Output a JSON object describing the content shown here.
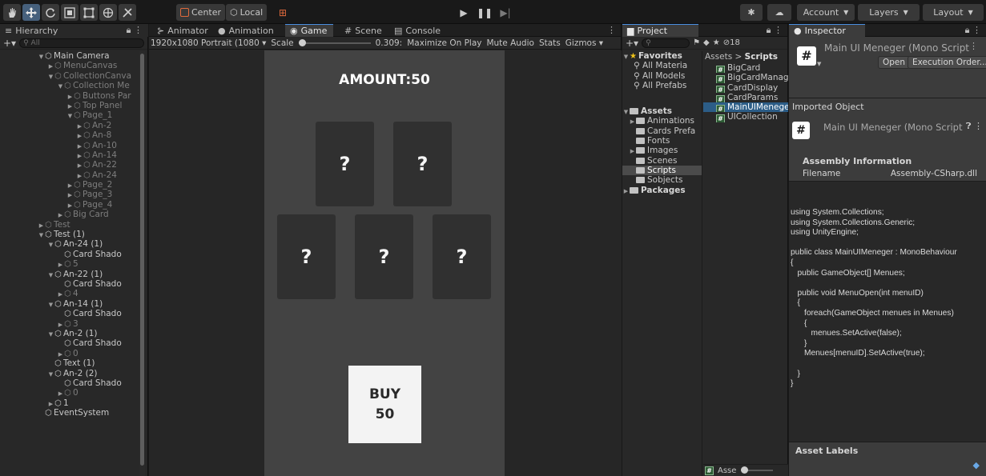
{
  "toolbar": {
    "pivot_label": "Center",
    "space_label": "Local",
    "account_label": "Account",
    "layers_label": "Layers",
    "layout_label": "Layout"
  },
  "hierarchy": {
    "tab_label": "Hierarchy",
    "search_placeholder": "All",
    "rows": [
      {
        "label": "Main Camera",
        "arrow": "▼",
        "depth": 1,
        "dim": false
      },
      {
        "label": "MenuCanvas",
        "arrow": "▶",
        "depth": 2,
        "dim": true
      },
      {
        "label": "CollectionCanva",
        "arrow": "▼",
        "depth": 2,
        "dim": true
      },
      {
        "label": "Collection Me",
        "arrow": "▼",
        "depth": 3,
        "dim": true
      },
      {
        "label": "Buttons Par",
        "arrow": "▶",
        "depth": 4,
        "dim": true
      },
      {
        "label": "Top Panel",
        "arrow": "▶",
        "depth": 4,
        "dim": true
      },
      {
        "label": "Page_1",
        "arrow": "▼",
        "depth": 4,
        "dim": true
      },
      {
        "label": "An-2",
        "arrow": "▶",
        "depth": 5,
        "dim": true
      },
      {
        "label": "An-8",
        "arrow": "▶",
        "depth": 5,
        "dim": true
      },
      {
        "label": "An-10",
        "arrow": "▶",
        "depth": 5,
        "dim": true
      },
      {
        "label": "An-14",
        "arrow": "▶",
        "depth": 5,
        "dim": true
      },
      {
        "label": "An-22",
        "arrow": "▶",
        "depth": 5,
        "dim": true
      },
      {
        "label": "An-24",
        "arrow": "▶",
        "depth": 5,
        "dim": true
      },
      {
        "label": "Page_2",
        "arrow": "▶",
        "depth": 4,
        "dim": true
      },
      {
        "label": "Page_3",
        "arrow": "▶",
        "depth": 4,
        "dim": true
      },
      {
        "label": "Page_4",
        "arrow": "▶",
        "depth": 4,
        "dim": true
      },
      {
        "label": "Big Card",
        "arrow": "▶",
        "depth": 3,
        "dim": true
      },
      {
        "label": "Test",
        "arrow": "▶",
        "depth": 1,
        "dim": true
      },
      {
        "label": "Test (1)",
        "arrow": "▼",
        "depth": 1,
        "dim": false
      },
      {
        "label": "An-24 (1)",
        "arrow": "▼",
        "depth": 2,
        "dim": false
      },
      {
        "label": "Card Shado",
        "arrow": "",
        "depth": 3,
        "dim": false
      },
      {
        "label": "5",
        "arrow": "▶",
        "depth": 3,
        "dim": true
      },
      {
        "label": "An-22 (1)",
        "arrow": "▼",
        "depth": 2,
        "dim": false
      },
      {
        "label": "Card Shado",
        "arrow": "",
        "depth": 3,
        "dim": false
      },
      {
        "label": "4",
        "arrow": "▶",
        "depth": 3,
        "dim": true
      },
      {
        "label": "An-14 (1)",
        "arrow": "▼",
        "depth": 2,
        "dim": false
      },
      {
        "label": "Card Shado",
        "arrow": "",
        "depth": 3,
        "dim": false
      },
      {
        "label": "3",
        "arrow": "▶",
        "depth": 3,
        "dim": true
      },
      {
        "label": "An-2 (1)",
        "arrow": "▼",
        "depth": 2,
        "dim": false
      },
      {
        "label": "Card Shado",
        "arrow": "",
        "depth": 3,
        "dim": false
      },
      {
        "label": "0",
        "arrow": "▶",
        "depth": 3,
        "dim": true
      },
      {
        "label": "Text (1)",
        "arrow": "",
        "depth": 2,
        "dim": false
      },
      {
        "label": "An-2 (2)",
        "arrow": "▼",
        "depth": 2,
        "dim": false
      },
      {
        "label": "Card Shado",
        "arrow": "",
        "depth": 3,
        "dim": false
      },
      {
        "label": "0",
        "arrow": "▶",
        "depth": 3,
        "dim": true
      },
      {
        "label": "1",
        "arrow": "▶",
        "depth": 2,
        "dim": false
      },
      {
        "label": "EventSystem",
        "arrow": "",
        "depth": 1,
        "dim": false
      }
    ]
  },
  "game": {
    "tabs": [
      {
        "label": "Animator",
        "icon": "⊱"
      },
      {
        "label": "Animation",
        "icon": "●"
      },
      {
        "label": "Game",
        "icon": "◉"
      },
      {
        "label": "Scene",
        "icon": "#"
      },
      {
        "label": "Console",
        "icon": "▤"
      }
    ],
    "resolution": "1920x1080 Portrait (1080",
    "scale_label": "Scale",
    "scale_value": "0.309:",
    "maximize": "Maximize On Play",
    "mute": "Mute Audio",
    "stats": "Stats",
    "gizmos": "Gizmos",
    "amount_text": "AMOUNT:50",
    "card_symbol": "?",
    "buy_line1": "BUY",
    "buy_line2": "50"
  },
  "project": {
    "tab_label": "Project",
    "hidden_count": "18",
    "breadcrumb_root": "Assets",
    "breadcrumb_sep": ">",
    "breadcrumb_current": "Scripts",
    "favorites_label": "Favorites",
    "favorites": [
      "All Materia",
      "All Models",
      "All Prefabs"
    ],
    "assets_label": "Assets",
    "asset_folders": [
      {
        "label": "Animations",
        "arrow": "▶"
      },
      {
        "label": "Cards Prefa",
        "arrow": ""
      },
      {
        "label": "Fonts",
        "arrow": ""
      },
      {
        "label": "Images",
        "arrow": "▶"
      },
      {
        "label": "Scenes",
        "arrow": ""
      },
      {
        "label": "Scripts",
        "arrow": "",
        "selected": true
      },
      {
        "label": "Sobjects",
        "arrow": ""
      }
    ],
    "packages_label": "Packages",
    "scripts": [
      {
        "label": "BigCard",
        "selected": false
      },
      {
        "label": "BigCardManag",
        "selected": false
      },
      {
        "label": "CardDisplay",
        "selected": false
      },
      {
        "label": "CardParams",
        "selected": false
      },
      {
        "label": "MainUIMenege",
        "selected": true
      },
      {
        "label": "UICollection",
        "selected": false
      }
    ],
    "bottom_label": "Asse"
  },
  "inspector": {
    "tab_label": "Inspector",
    "title": "Main UI Meneger (Mono Script",
    "open_button": "Open",
    "exec_order_button": "Execution Order...",
    "imported_label": "Imported Object",
    "imported_title": "Main UI Meneger (Mono Script",
    "assembly_header": "Assembly Information",
    "filename_label": "Filename",
    "filename_value": "Assembly-CSharp.dll",
    "code": "using System.Collections;\nusing System.Collections.Generic;\nusing UnityEngine;\n\npublic class MainUIMeneger : MonoBehaviour\n{\n   public GameObject[] Menues;\n\n   public void MenuOpen(int menuID)\n   {\n      foreach(GameObject menues in Menues)\n      {\n         menues.SetActive(false);\n      }\n      Menues[menuID].SetActive(true);\n\n   }\n}",
    "asset_labels": "Asset Labels"
  }
}
